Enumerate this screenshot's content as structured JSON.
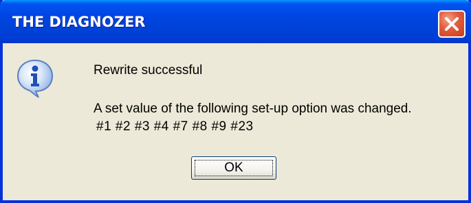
{
  "window": {
    "title": "THE DIAGNOZER"
  },
  "dialog": {
    "icon": "info-icon",
    "line1": "Rewrite successful",
    "line2": "A set value of the following set-up option was changed.",
    "line3": "#1 #2 #3 #4 #7 #8 #9 #23",
    "ok_label": "OK"
  },
  "colors": {
    "titlebar": "#0054e3",
    "face": "#ece9d8",
    "close": "#e0532f"
  }
}
